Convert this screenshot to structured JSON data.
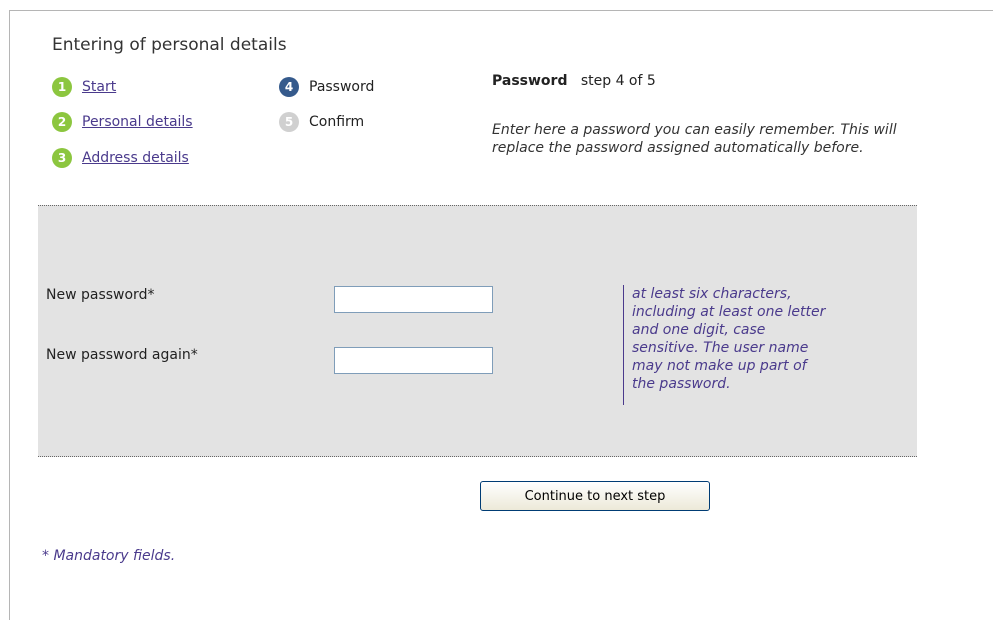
{
  "page": {
    "title": "Entering of personal details"
  },
  "steps": [
    {
      "number": "1",
      "label": "Start",
      "state": "done"
    },
    {
      "number": "2",
      "label": "Personal details",
      "state": "done"
    },
    {
      "number": "3",
      "label": "Address details",
      "state": "done"
    },
    {
      "number": "4",
      "label": "Password",
      "state": "current"
    },
    {
      "number": "5",
      "label": "Confirm",
      "state": "todo"
    }
  ],
  "info": {
    "heading": "Password",
    "step_text": "step 4 of 5",
    "description": "Enter here a password you can easily remember. This will replace the password assigned automatically before."
  },
  "form": {
    "new_password_label": "New password*",
    "new_password_value": "",
    "new_password_again_label": "New password again*",
    "new_password_again_value": "",
    "hint": "at least six characters, including at least one letter and one digit, case sensitive. The user name may not make up part of the password."
  },
  "actions": {
    "continue_label": "Continue to next step"
  },
  "footer": {
    "mandatory_note": "* Mandatory fields."
  },
  "colors": {
    "step_done": "#8cc63f",
    "step_current": "#355a8c",
    "step_todo": "#d0d0d0",
    "link": "#4a3a8c",
    "panel_bg": "#e3e3e3"
  },
  "icons": {
    "step_done": "green-circle-number-icon",
    "step_current": "blue-circle-number-icon",
    "step_todo": "gray-circle-number-icon"
  }
}
